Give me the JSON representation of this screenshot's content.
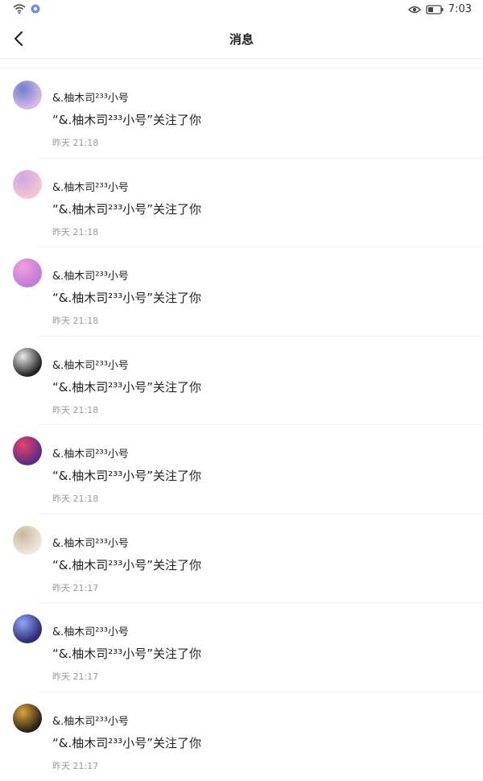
{
  "status": {
    "time": "7:03"
  },
  "header": {
    "title": "消息"
  },
  "items": [
    {
      "name": "&.柚木司²³³小号",
      "message": "“&.柚木司²³³小号”关注了你",
      "time": "昨天 21:18",
      "avatar_colors": [
        "#d9b8e6",
        "#6d7fcf"
      ]
    },
    {
      "name": "&.柚木司²³³小号",
      "message": "“&.柚木司²³³小号”关注了你",
      "time": "昨天 21:18",
      "avatar_colors": [
        "#f3c6cf",
        "#cfa6e0"
      ]
    },
    {
      "name": "&.柚木司²³³小号",
      "message": "“&.柚木司²³³小号”关注了你",
      "time": "昨天 21:18",
      "avatar_colors": [
        "#c07ad9",
        "#f0a0d8"
      ]
    },
    {
      "name": "&.柚木司²³³小号",
      "message": "“&.柚木司²³³小号”关注了你",
      "time": "昨天 21:18",
      "avatar_colors": [
        "#222222",
        "#eaeaea"
      ]
    },
    {
      "name": "&.柚木司²³³小号",
      "message": "“&.柚木司²³³小号”关注了你",
      "time": "昨天 21:18",
      "avatar_colors": [
        "#5b2b86",
        "#e6436b"
      ]
    },
    {
      "name": "&.柚木司²³³小号",
      "message": "“&.柚木司²³³小号”关注了你",
      "time": "昨天 21:17",
      "avatar_colors": [
        "#efe7dc",
        "#c9b79c"
      ]
    },
    {
      "name": "&.柚木司²³³小号",
      "message": "“&.柚木司²³³小号”关注了你",
      "time": "昨天 21:17",
      "avatar_colors": [
        "#2b2a6e",
        "#8ea6ff"
      ]
    },
    {
      "name": "&.柚木司²³³小号",
      "message": "“&.柚木司²³³小号”关注了你",
      "time": "昨天 21:17",
      "avatar_colors": [
        "#2a1f18",
        "#d9a63a"
      ]
    }
  ]
}
